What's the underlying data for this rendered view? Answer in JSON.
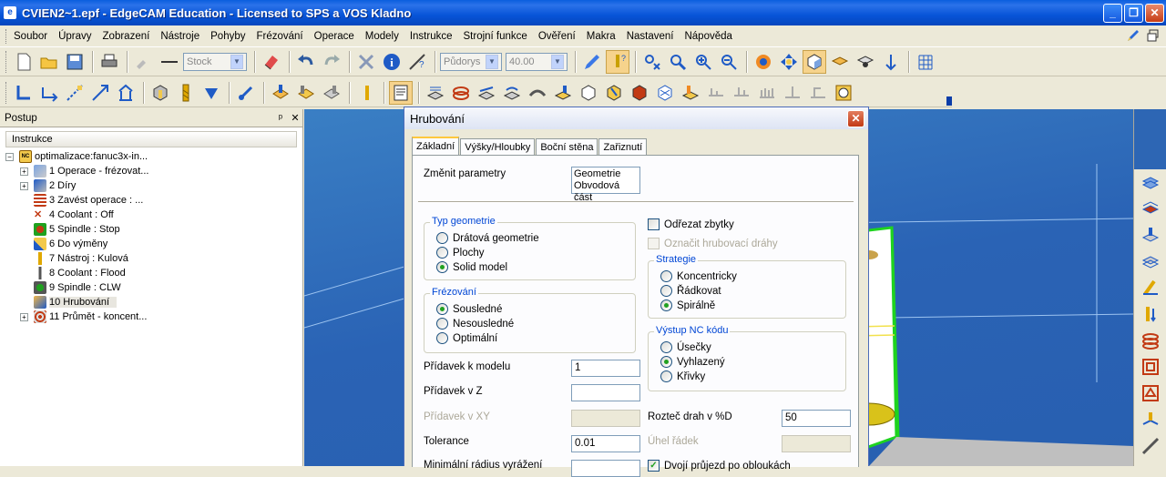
{
  "window": {
    "title": "CVIEN2~1.epf - EdgeCAM Education - Licensed to SPS a VOS Kladno",
    "minimize": "_",
    "maximize": "❐",
    "close": "✕"
  },
  "menu": [
    "Soubor",
    "Úpravy",
    "Zobrazení",
    "Nástroje",
    "Pohyby",
    "Frézování",
    "Operace",
    "Modely",
    "Instrukce",
    "Strojní funkce",
    "Ověření",
    "Makra",
    "Nastavení",
    "Nápověda"
  ],
  "toolbar": {
    "stock_combo": "Stock",
    "view_combo": "Půdorys",
    "depth_combo": "40.00"
  },
  "panel": {
    "title": "Postup",
    "pin": "ᵖ",
    "close": "✕",
    "column": "Instrukce",
    "root": "optimalizace:fanuc3x-in...",
    "items": [
      {
        "label": "1 Operace - frézovat...",
        "expandable": true
      },
      {
        "label": "2 Díry",
        "expandable": true
      },
      {
        "label": "3 Zavést operace : ...",
        "expandable": false
      },
      {
        "label": "4 Coolant : Off",
        "expandable": false
      },
      {
        "label": "5 Spindle :     Stop",
        "expandable": false
      },
      {
        "label": "6 Do výměny",
        "expandable": false
      },
      {
        "label": "7 Nástroj : Kulová",
        "expandable": false
      },
      {
        "label": "8 Coolant : Flood",
        "expandable": false
      },
      {
        "label": "9 Spindle : CLW",
        "expandable": false
      },
      {
        "label": "10 Hrubování",
        "expandable": false,
        "selected": true
      },
      {
        "label": "11 Průmět - koncent...",
        "expandable": true
      }
    ]
  },
  "dialog": {
    "title": "Hrubování",
    "close": "✕",
    "tabs": [
      "Základní",
      "Výšky/Hloubky",
      "Boční stěna",
      "Zařiznutí"
    ],
    "change_params_label": "Změnit parametry",
    "change_params_value": [
      "Geometrie",
      "Obvodová část"
    ],
    "geometry_group": {
      "title": "Typ geometrie",
      "options": [
        "Drátová geometrie",
        "Plochy",
        "Solid model"
      ],
      "selected": 2
    },
    "milling_group": {
      "title": "Frézování",
      "options": [
        "Sousledné",
        "Nesousledné",
        "Optimální"
      ],
      "selected": 0
    },
    "cut_remains": "Odřezat zbytky",
    "mark_paths": "Označit hrubovací dráhy",
    "strategy_group": {
      "title": "Strategie",
      "options": [
        "Koncentricky",
        "Řádkovat",
        "Spirálně"
      ],
      "selected": 2
    },
    "nc_group": {
      "title": "Výstup NC kódu",
      "options": [
        "Úsečky",
        "Vyhlazený",
        "Křivky"
      ],
      "selected": 1
    },
    "allowance_model_label": "Přídavek k modelu",
    "allowance_model_value": "1",
    "allowance_z_label": "Přídavek v Z",
    "allowance_z_value": "",
    "allowance_xy_label": "Přídavek v XY",
    "allowance_xy_value": "",
    "stepover_label": "Rozteč drah v %D",
    "stepover_value": "50",
    "tolerance_label": "Tolerance",
    "tolerance_value": "0.01",
    "row_angle_label": "Úhel řádek",
    "row_angle_value": "",
    "min_radius_label": "Minimální rádius vyrážení",
    "double_pass_label": "Dvojí průjezd po obloukách",
    "double_pass_checked": true
  },
  "colors": {
    "title_blue": "#0754d8",
    "viewport": "#2a63b5",
    "group_title": "#0046d5",
    "part_green": "#1fd31f",
    "tab_highlight": "#ffc83c"
  }
}
